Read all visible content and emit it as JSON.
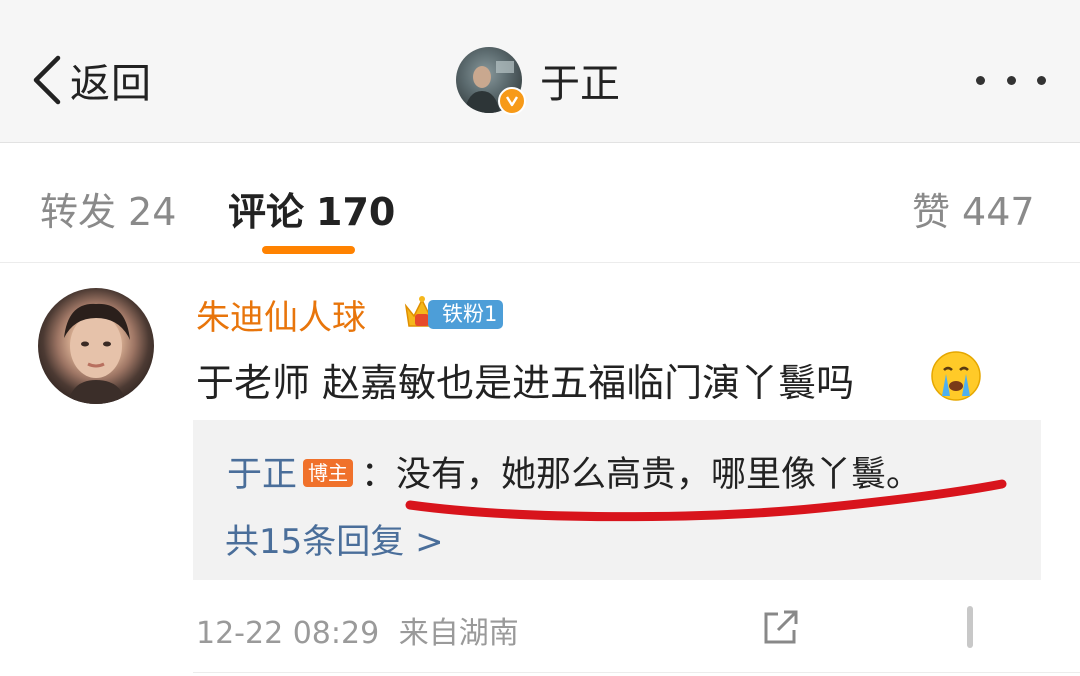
{
  "header": {
    "back_label": "返回",
    "title": "于正"
  },
  "tabs": {
    "repost_label": "转发",
    "repost_count": "24",
    "comment_label": "评论",
    "comment_count": "170",
    "like_label": "赞",
    "like_count": "447",
    "accent_color": "#ff8200"
  },
  "comment": {
    "username": "朱迪仙人球",
    "fan_badge": "铁粉1",
    "text": "于老师 赵嘉敏也是进五福临门演丫鬟吗",
    "emoji": "crying-face-icon",
    "reply": {
      "user": "于正",
      "badge": "博主",
      "separator": "：",
      "text": "没有，她那么高贵，哪里像丫鬟。"
    },
    "more_replies": "共15条回复 >",
    "timestamp": "12-22 08:29",
    "source": "来自湖南"
  },
  "colors": {
    "username": "#e8750b",
    "link_blue": "#4a6e9a",
    "annotation_red": "#d8141c"
  }
}
